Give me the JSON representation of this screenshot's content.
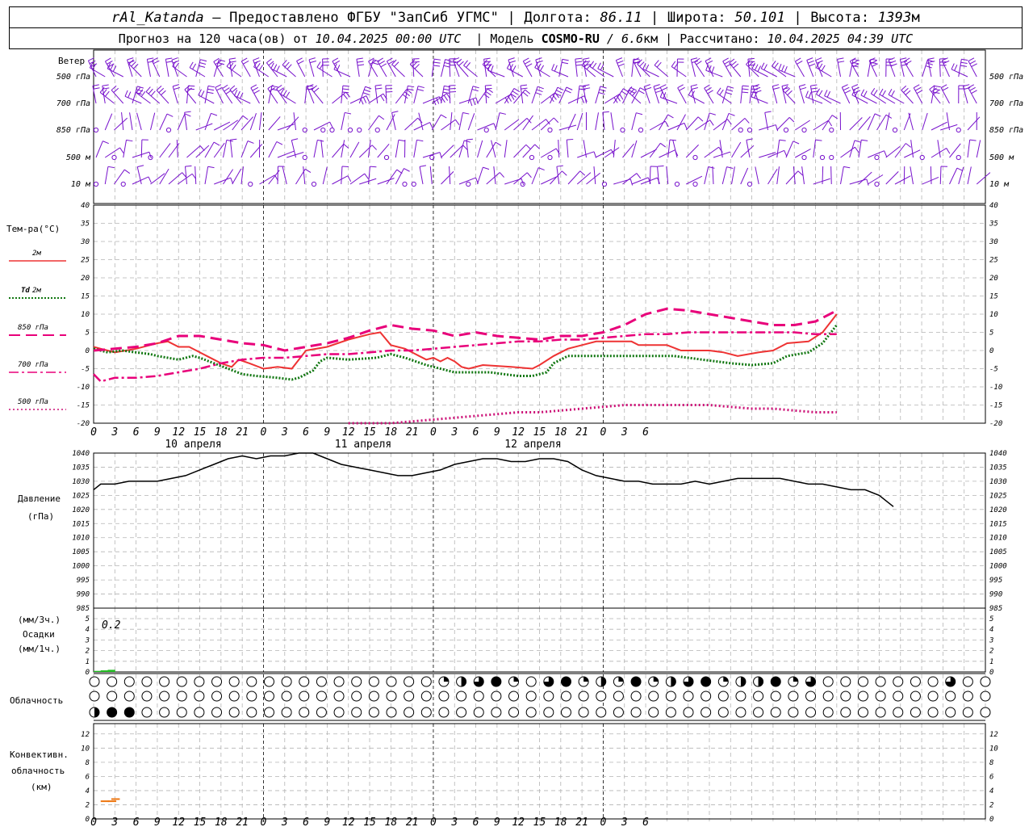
{
  "header": {
    "station": "rAl_Katanda",
    "provided": " — Предоставлено ФГБУ \"ЗапСиб УГМС\" | Долгота: ",
    "lon": "86.11",
    "lat_label": " | Широта: ",
    "lat": "50.101",
    "alt_label": " | Высота: ",
    "alt": "1393",
    "alt_unit": "м",
    "forecast_label": "Прогноз на 120 часа(ов) от ",
    "start_time": "10.04.2025 00:00 UTC",
    "model_label": "  | Модель ",
    "model": "COSMO-RU",
    "model_res": " / 6.6",
    "model_res_unit": "км",
    "calc_label": " | Рассчитано: ",
    "calc_time": "10.04.2025 04:39 UTC"
  },
  "labels": {
    "wind": "Ветер",
    "temp": "Тем-ра(°С)",
    "t2m": "2м",
    "td": "Td",
    "td2m": " 2м",
    "p850": "850 гПа",
    "p700": "700 гПа",
    "p500": "500 гПа",
    "pressure1": "Давление",
    "pressure2": "(гПа)",
    "precip1": "(мм/3ч.)",
    "precip2": "Осадки",
    "precip3": "(мм/1ч.)",
    "cloud": "Облачность",
    "conv1": "Конвективн.",
    "conv2": "облачность",
    "conv3": "(км)"
  },
  "wind_levels": [
    "500 гПа",
    "700 гПа",
    "850 гПа",
    "500 м",
    "10 м"
  ],
  "colors": {
    "t2m": "#ee3333",
    "td": "#117711",
    "p850": "#e8007a",
    "p700": "#e8007a",
    "p500": "#cc1177",
    "wind": "#7711cc",
    "precip": "#22bb22",
    "conv": "#ee7711"
  },
  "chart_data": {
    "type": "line",
    "x_tick_labels": [
      "0",
      "3",
      "6",
      "9",
      "12",
      "15",
      "18",
      "21",
      "0",
      "3",
      "6",
      "9",
      "12",
      "15",
      "18",
      "21",
      "0",
      "3",
      "6",
      "9",
      "12",
      "15",
      "18",
      "21",
      "0",
      "3",
      "6"
    ],
    "day_labels": [
      "10 апреля",
      "11 апреля",
      "12 апреля"
    ],
    "temperature": {
      "ylim": [
        -20,
        40
      ],
      "ticks": [
        -20,
        -15,
        -10,
        -5,
        0,
        5,
        10,
        15,
        20,
        25,
        30,
        35,
        40
      ],
      "series": [
        {
          "name": "2м",
          "key": "t2m",
          "points": [
            [
              0,
              1
            ],
            [
              3,
              -0.5
            ],
            [
              6,
              0.5
            ],
            [
              9,
              2
            ],
            [
              10.5,
              2.5
            ],
            [
              12,
              1
            ],
            [
              13.5,
              1
            ],
            [
              16,
              -1.5
            ],
            [
              18,
              -3.5
            ],
            [
              19.5,
              -4.5
            ],
            [
              20.5,
              -2.5
            ],
            [
              22,
              -3.5
            ],
            [
              24,
              -5
            ],
            [
              26,
              -4.5
            ],
            [
              28,
              -5
            ],
            [
              30,
              0
            ],
            [
              33,
              1
            ],
            [
              36,
              3
            ],
            [
              39,
              4.5
            ],
            [
              40.5,
              5
            ],
            [
              42,
              1.5
            ],
            [
              44,
              0.5
            ],
            [
              46,
              -1.5
            ],
            [
              47,
              -2.5
            ],
            [
              48,
              -2
            ],
            [
              49,
              -3
            ],
            [
              50,
              -2
            ],
            [
              51,
              -3
            ],
            [
              52,
              -4.5
            ],
            [
              53,
              -5
            ],
            [
              55,
              -4
            ],
            [
              59,
              -4.5
            ],
            [
              62,
              -5
            ],
            [
              63,
              -4
            ],
            [
              65,
              -1.5
            ],
            [
              66,
              -0.5
            ],
            [
              67,
              0.5
            ],
            [
              69,
              1.5
            ],
            [
              71,
              2.5
            ],
            [
              76,
              2.5
            ],
            [
              77,
              1.5
            ],
            [
              80,
              1.5
            ],
            [
              81,
              1.5
            ],
            [
              83,
              0
            ],
            [
              87,
              0
            ],
            [
              89,
              -0.5
            ],
            [
              91,
              -1.5
            ],
            [
              94,
              -0.5
            ],
            [
              96,
              0
            ],
            [
              98,
              2
            ],
            [
              101,
              2.5
            ],
            [
              103,
              5
            ],
            [
              105,
              10
            ]
          ]
        },
        {
          "name": "Td 2м",
          "key": "td",
          "points": [
            [
              0,
              0.5
            ],
            [
              2,
              -0.5
            ],
            [
              4,
              0
            ],
            [
              6,
              -0.5
            ],
            [
              8,
              -1
            ],
            [
              9,
              -1.5
            ],
            [
              12,
              -2.5
            ],
            [
              14,
              -1.5
            ],
            [
              15,
              -2
            ],
            [
              17,
              -3.5
            ],
            [
              19,
              -5
            ],
            [
              21,
              -6.5
            ],
            [
              23,
              -7
            ],
            [
              26,
              -7.5
            ],
            [
              28,
              -8
            ],
            [
              29,
              -7.5
            ],
            [
              30,
              -6.5
            ],
            [
              31,
              -5.5
            ],
            [
              32,
              -3
            ],
            [
              33,
              -2
            ],
            [
              36,
              -2.5
            ],
            [
              40,
              -2
            ],
            [
              42,
              -1
            ],
            [
              44,
              -2
            ],
            [
              47,
              -4
            ],
            [
              49,
              -5
            ],
            [
              51,
              -6
            ],
            [
              53,
              -6
            ],
            [
              56,
              -6
            ],
            [
              58,
              -6.5
            ],
            [
              60,
              -7
            ],
            [
              62,
              -7
            ],
            [
              64,
              -6
            ],
            [
              65,
              -3.5
            ],
            [
              67,
              -1.5
            ],
            [
              75,
              -1.5
            ],
            [
              78,
              -1.5
            ],
            [
              82,
              -1.5
            ],
            [
              84,
              -2
            ],
            [
              86,
              -2.5
            ],
            [
              88,
              -3
            ],
            [
              90,
              -3.5
            ],
            [
              93,
              -4
            ],
            [
              96,
              -3.5
            ],
            [
              98,
              -1.5
            ],
            [
              101,
              -0.5
            ],
            [
              103,
              2
            ],
            [
              105,
              7
            ]
          ]
        },
        {
          "name": "850 гПа",
          "key": "p850",
          "points": [
            [
              0,
              0
            ],
            [
              3,
              0.5
            ],
            [
              6,
              1
            ],
            [
              9,
              2
            ],
            [
              12,
              4
            ],
            [
              15,
              4
            ],
            [
              18,
              3
            ],
            [
              21,
              2
            ],
            [
              24,
              1.5
            ],
            [
              27,
              0
            ],
            [
              30,
              1
            ],
            [
              33,
              2
            ],
            [
              36,
              3.5
            ],
            [
              39,
              5.5
            ],
            [
              42,
              7
            ],
            [
              45,
              6
            ],
            [
              48,
              5.5
            ],
            [
              51,
              4
            ],
            [
              54,
              5
            ],
            [
              57,
              4
            ],
            [
              60,
              3.5
            ],
            [
              63,
              3
            ],
            [
              66,
              4
            ],
            [
              69,
              4
            ],
            [
              72,
              5
            ],
            [
              75,
              7
            ],
            [
              78,
              10
            ],
            [
              81,
              11.5
            ],
            [
              84,
              11
            ],
            [
              87,
              10
            ],
            [
              90,
              9
            ],
            [
              93,
              8
            ],
            [
              96,
              7
            ],
            [
              99,
              7
            ],
            [
              102,
              8
            ],
            [
              105,
              11
            ]
          ]
        },
        {
          "name": "700 гПа",
          "key": "p700",
          "points": [
            [
              0,
              -6.5
            ],
            [
              1,
              -8.5
            ],
            [
              3,
              -7.5
            ],
            [
              6,
              -7.5
            ],
            [
              9,
              -7
            ],
            [
              12,
              -6
            ],
            [
              15,
              -5
            ],
            [
              18,
              -3.5
            ],
            [
              21,
              -2.5
            ],
            [
              24,
              -2
            ],
            [
              27,
              -2
            ],
            [
              30,
              -1.5
            ],
            [
              33,
              -1
            ],
            [
              36,
              -1
            ],
            [
              39,
              -0.5
            ],
            [
              42,
              0
            ],
            [
              45,
              0
            ],
            [
              48,
              0.5
            ],
            [
              51,
              1
            ],
            [
              54,
              1.5
            ],
            [
              57,
              2
            ],
            [
              60,
              2.5
            ],
            [
              63,
              2.5
            ],
            [
              66,
              3
            ],
            [
              69,
              3
            ],
            [
              72,
              3.5
            ],
            [
              75,
              4
            ],
            [
              78,
              4.5
            ],
            [
              81,
              4.5
            ],
            [
              84,
              5
            ],
            [
              87,
              5
            ],
            [
              90,
              5
            ],
            [
              93,
              5
            ],
            [
              96,
              5
            ],
            [
              99,
              5
            ],
            [
              102,
              4.5
            ],
            [
              105,
              4.5
            ]
          ]
        },
        {
          "name": "500 гПа",
          "key": "p500",
          "points": [
            [
              36,
              -20
            ],
            [
              39,
              -20
            ],
            [
              42,
              -20
            ],
            [
              45,
              -19.5
            ],
            [
              48,
              -19
            ],
            [
              51,
              -18.5
            ],
            [
              54,
              -18
            ],
            [
              57,
              -17.5
            ],
            [
              60,
              -17
            ],
            [
              63,
              -17
            ],
            [
              66,
              -16.5
            ],
            [
              69,
              -16
            ],
            [
              72,
              -15.5
            ],
            [
              75,
              -15
            ],
            [
              78,
              -15
            ],
            [
              81,
              -15
            ],
            [
              84,
              -15
            ],
            [
              87,
              -15
            ],
            [
              90,
              -15.5
            ],
            [
              93,
              -16
            ],
            [
              96,
              -16
            ],
            [
              99,
              -16.5
            ],
            [
              102,
              -17
            ],
            [
              105,
              -17
            ]
          ]
        }
      ]
    },
    "pressure": {
      "ylim": [
        985,
        1040
      ],
      "ticks": [
        985,
        990,
        995,
        1000,
        1005,
        1010,
        1015,
        1020,
        1025,
        1030,
        1035,
        1040
      ],
      "points": [
        [
          0,
          1027
        ],
        [
          1,
          1029
        ],
        [
          2,
          1029
        ],
        [
          3,
          1029
        ],
        [
          5,
          1030
        ],
        [
          7,
          1030
        ],
        [
          9,
          1030
        ],
        [
          11,
          1031
        ],
        [
          13,
          1032
        ],
        [
          15,
          1034
        ],
        [
          17,
          1036
        ],
        [
          19,
          1038
        ],
        [
          21,
          1039
        ],
        [
          23,
          1038
        ],
        [
          25,
          1039
        ],
        [
          27,
          1039
        ],
        [
          29,
          1040
        ],
        [
          31,
          1040
        ],
        [
          33,
          1038
        ],
        [
          35,
          1036
        ],
        [
          37,
          1035
        ],
        [
          39,
          1034
        ],
        [
          41,
          1033
        ],
        [
          43,
          1032
        ],
        [
          45,
          1032
        ],
        [
          47,
          1033
        ],
        [
          49,
          1034
        ],
        [
          51,
          1036
        ],
        [
          53,
          1037
        ],
        [
          55,
          1038
        ],
        [
          57,
          1038
        ],
        [
          59,
          1037
        ],
        [
          61,
          1037
        ],
        [
          63,
          1038
        ],
        [
          65,
          1038
        ],
        [
          67,
          1037
        ],
        [
          69,
          1034
        ],
        [
          71,
          1032
        ],
        [
          73,
          1031
        ],
        [
          75,
          1030
        ],
        [
          77,
          1030
        ],
        [
          79,
          1029
        ],
        [
          81,
          1029
        ],
        [
          83,
          1029
        ],
        [
          85,
          1030
        ],
        [
          87,
          1029
        ],
        [
          89,
          1030
        ],
        [
          91,
          1031
        ],
        [
          93,
          1031
        ],
        [
          95,
          1031
        ],
        [
          97,
          1031
        ],
        [
          99,
          1030
        ],
        [
          101,
          1029
        ],
        [
          103,
          1029
        ],
        [
          105,
          1028
        ],
        [
          107,
          1027
        ],
        [
          109,
          1027
        ],
        [
          111,
          1025
        ],
        [
          113,
          1021
        ]
      ]
    },
    "precip": {
      "ylim": [
        0,
        5
      ],
      "ticks": [
        0,
        1,
        2,
        3,
        4,
        5
      ],
      "note": "0.2",
      "bars": [
        [
          0,
          0.1
        ],
        [
          1,
          0.15
        ],
        [
          2,
          0.2
        ]
      ]
    },
    "clouds": {
      "rows": 3,
      "symbols_per_row": 52
    },
    "convective": {
      "ylim": [
        0,
        13
      ],
      "ticks": [
        0,
        2,
        4,
        6,
        8,
        10,
        12
      ],
      "segments": [
        [
          1,
          2.5
        ],
        [
          2,
          2.5
        ],
        [
          2.5,
          2.8
        ]
      ]
    }
  }
}
